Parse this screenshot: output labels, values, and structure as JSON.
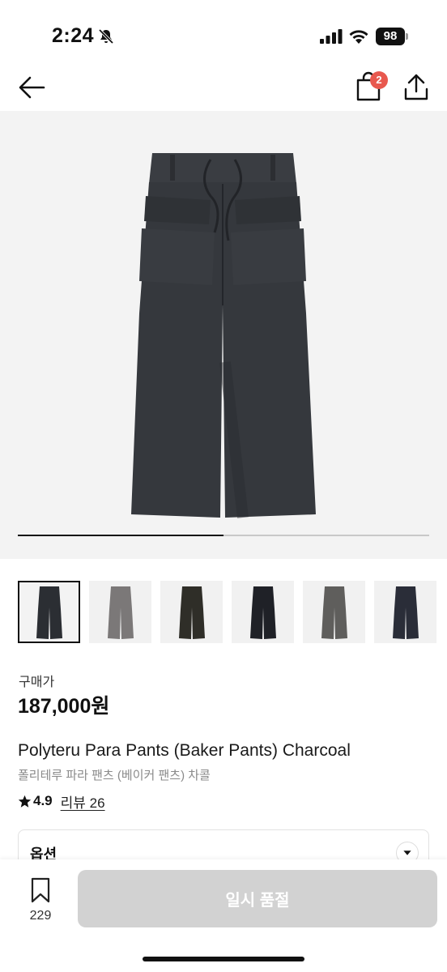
{
  "status_bar": {
    "time": "2:24",
    "battery": "98"
  },
  "nav": {
    "cart_badge": "2",
    "icons": [
      "arrow-left-icon",
      "shopping-bag-icon",
      "share-icon"
    ]
  },
  "carousel": {
    "progress": 0.5
  },
  "thumbnails": {
    "count": 6,
    "selected_index": 0,
    "colors": [
      "#2b2e33",
      "#7b7878",
      "#2f2e28",
      "#1f2127",
      "#5f5e5c",
      "#2a2d38"
    ]
  },
  "product": {
    "price_label": "구매가",
    "price": "187,000원",
    "title_en": "Polyteru Para Pants (Baker Pants) Charcoal",
    "title_ko": "폴리테루 파라 팬츠 (베이커 팬츠) 차콜",
    "rating": "4.9",
    "review_label": "리뷰 26"
  },
  "options": {
    "label": "옵션"
  },
  "bottom_bar": {
    "bookmark_count": "229",
    "cta_label": "일시 품절"
  },
  "colors": {
    "badge": "#e8584e",
    "cta_disabled": "#d2d2d2",
    "pants": "#35383d"
  }
}
